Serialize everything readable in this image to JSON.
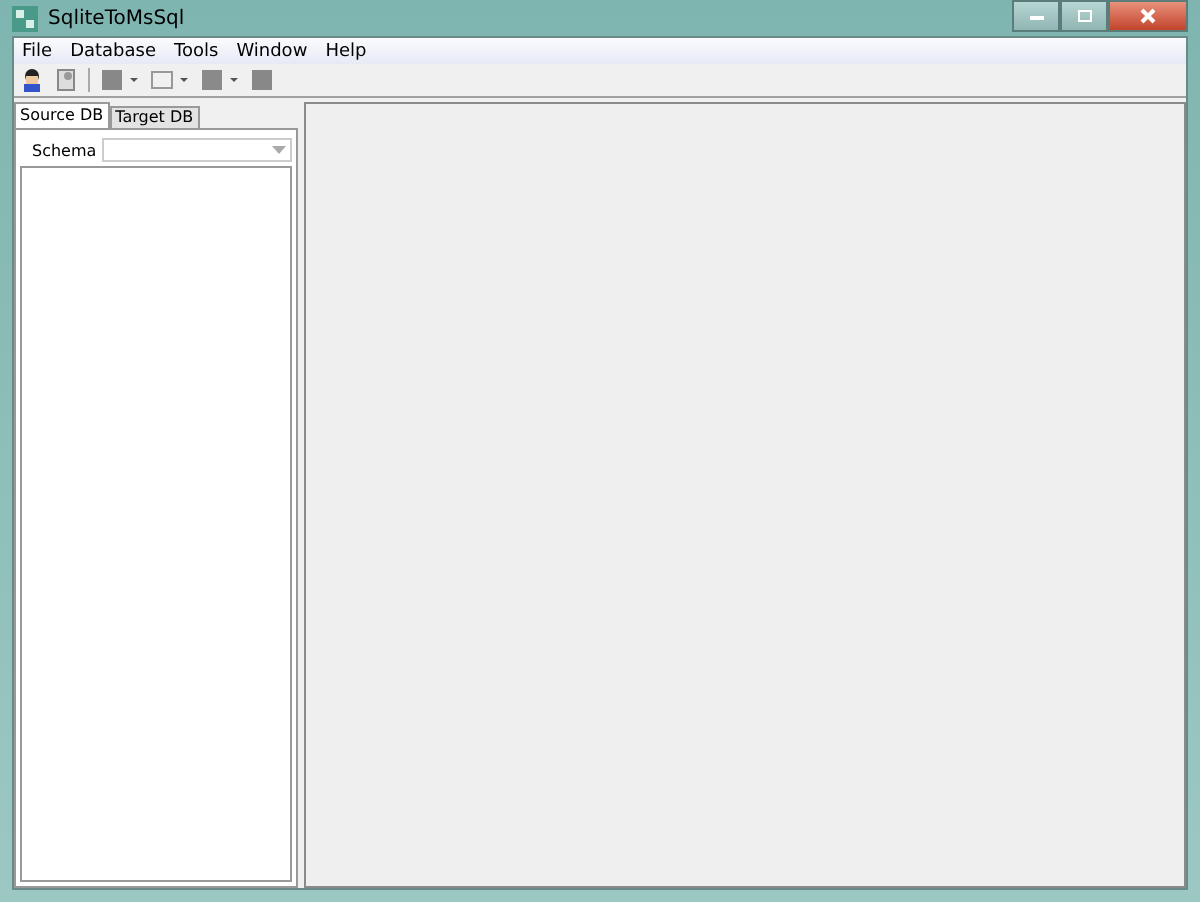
{
  "window": {
    "title": "SqliteToMsSql"
  },
  "menu": [
    "File",
    "Database",
    "Tools",
    "Window",
    "Help"
  ],
  "tabs": [
    {
      "label": "Source DB",
      "selected": true
    },
    {
      "label": "Target DB",
      "selected": false
    }
  ],
  "schema": {
    "label": "Schema"
  }
}
